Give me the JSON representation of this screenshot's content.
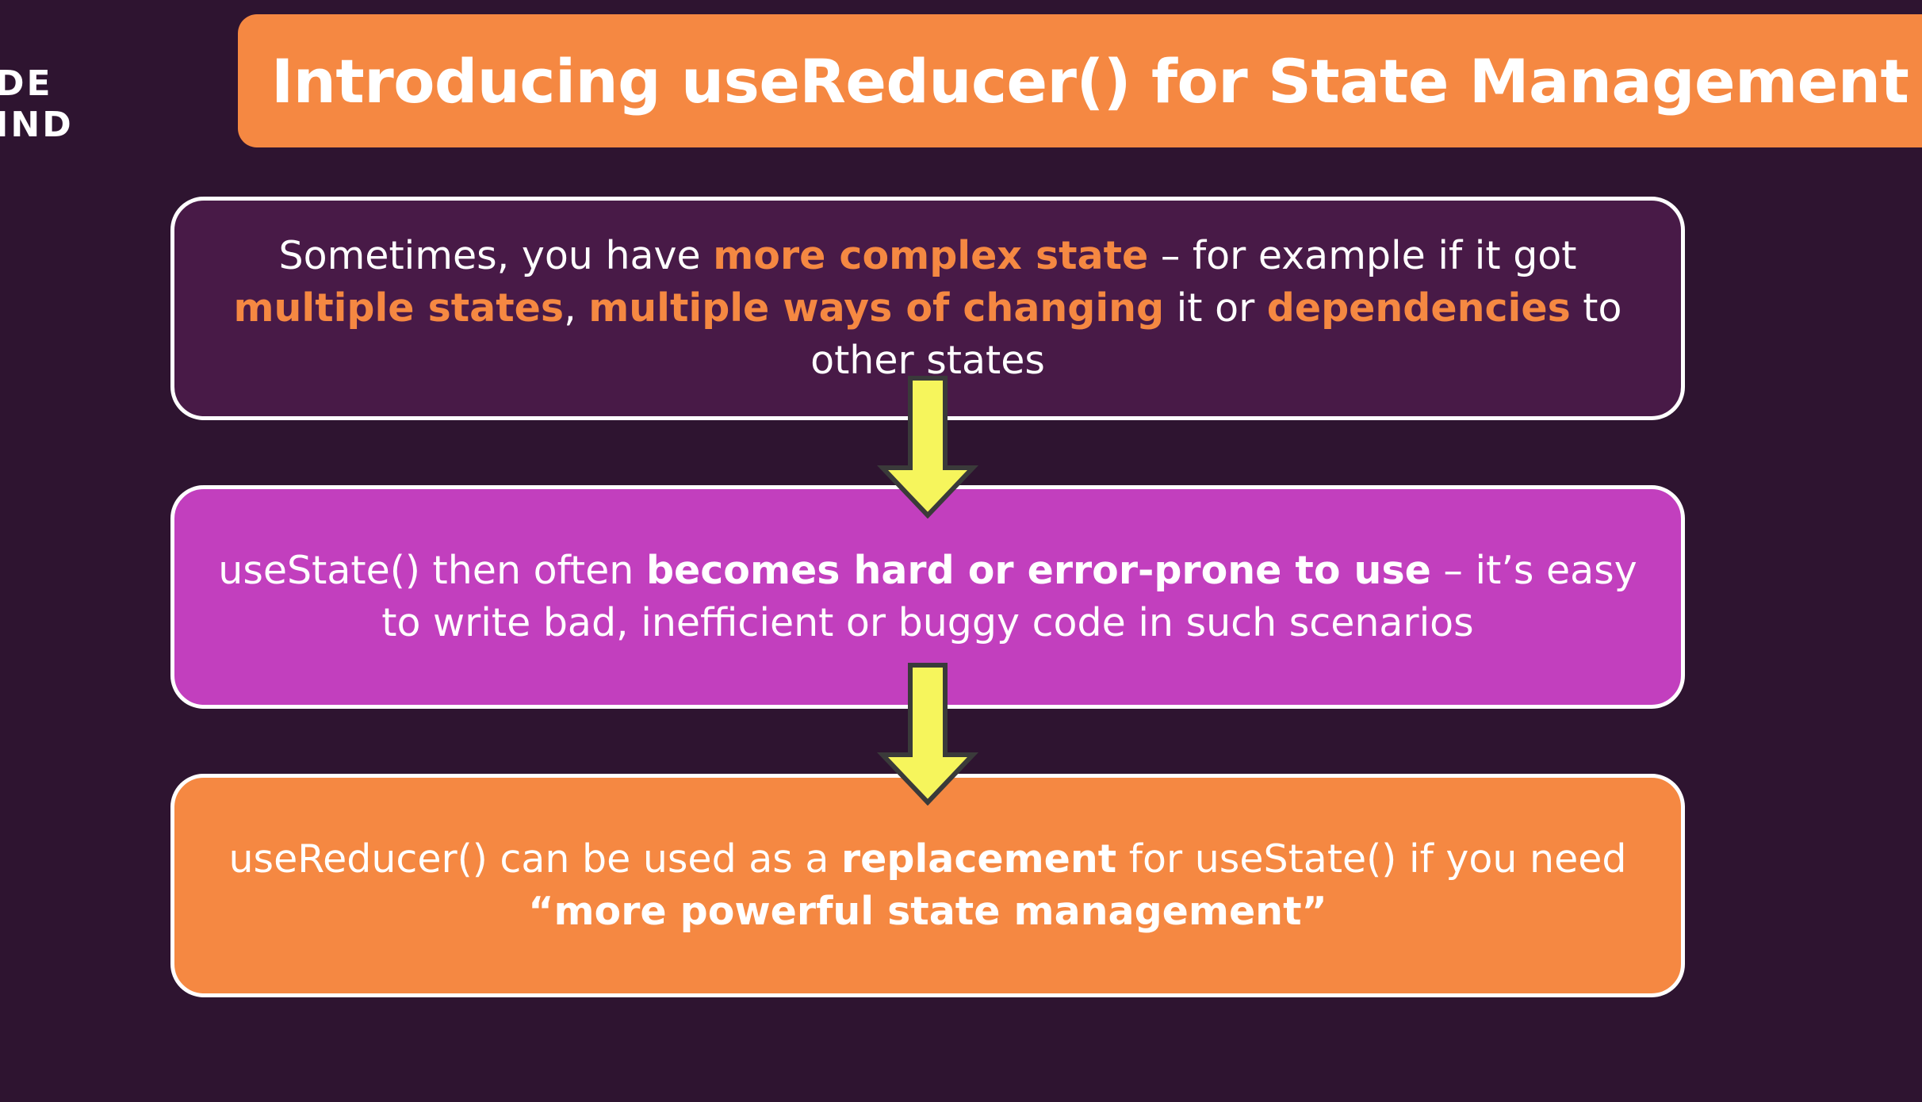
{
  "logo": {
    "line1": "DE",
    "line2": "IND"
  },
  "title": "Introducing useReducer() for State Management",
  "box1": {
    "t1": "Sometimes, you have ",
    "h1": "more complex state",
    "t2": " – for example if it got ",
    "h2": "multiple states",
    "t3": ", ",
    "h3": "multiple ways of changing",
    "t4": " it or ",
    "h4": "dependencies",
    "t5": " to other states"
  },
  "box2": {
    "t1": "useState() then often ",
    "b1": "becomes hard or error-prone to use",
    "t2": " – it’s easy to write bad, inefficient or buggy code in such scenarios"
  },
  "box3": {
    "t1": "useReducer() can be used as a ",
    "b1": "replacement",
    "t2": " for useState() if you need ",
    "q": "“more powerful state management”"
  },
  "colors": {
    "background": "#2e1430",
    "accent_orange": "#f58842",
    "box1_fill": "#481a47",
    "box2_fill": "#c23fbe",
    "arrow_fill": "#f6f55c"
  },
  "icons": {
    "arrow": "arrow-down-icon"
  }
}
